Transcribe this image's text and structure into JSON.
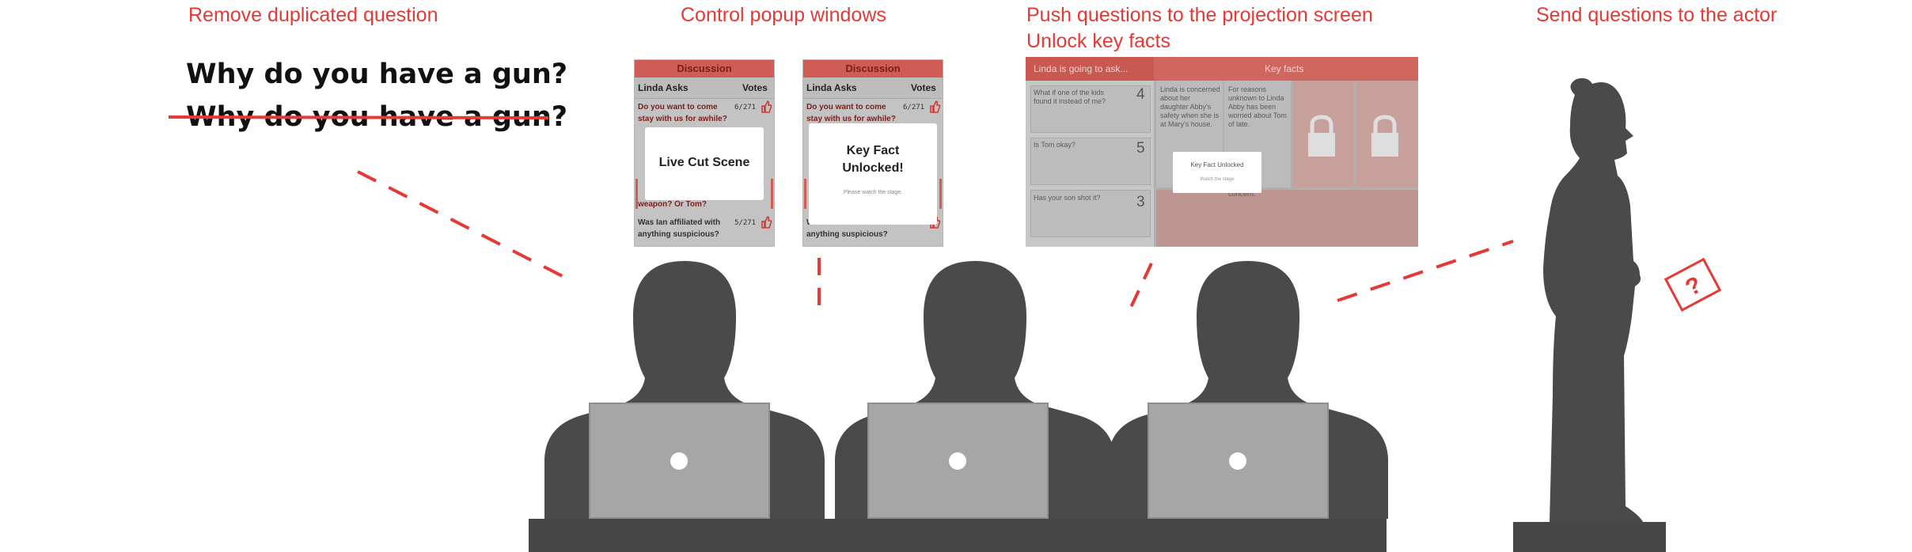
{
  "labels": {
    "remove": "Remove duplicated question",
    "control": "Control popup windows",
    "push": "Push questions to the projection screen",
    "unlock": "Unlock key facts",
    "send": "Send questions to the actor"
  },
  "duplicate_question": "Why do you have a gun?",
  "phone_left": {
    "title": "Discussion",
    "col_asks": "Linda Asks",
    "col_votes": "Votes",
    "q1_line1": "Do you want to come",
    "q1_line2": "stay with us for awhile?",
    "q1_votes": "6/271",
    "q2_partial": "weapon? Or Tom?",
    "q3_line1": "Was Ian affiliated with",
    "q3_line2": "anything suspicious?",
    "q3_votes": "5/271",
    "popup_text": "Live Cut Scene"
  },
  "phone_right": {
    "title": "Discussion",
    "col_asks": "Linda Asks",
    "col_votes": "Votes",
    "q1_line1": "Do you want to come",
    "q1_line2": "stay with us for awhile?",
    "q1_votes": "6/271",
    "q3_line1": "Was Ian affiliated with",
    "q3_line2": "anything suspicious?",
    "popup_line1": "Key Fact",
    "popup_line2": "Unlocked!",
    "popup_sub": "Please watch the stage."
  },
  "projection": {
    "left_header": "Linda is going to ask...",
    "right_header": "Key facts",
    "q1": "What if one of the kids found it instead of me?",
    "q1_votes": "4",
    "q2": "Is Tom okay?",
    "q2_votes": "5",
    "q3": "Has your son shot it?",
    "q3_votes": "3",
    "fact1": "Linda is concerned about her daughter Abby's safety when she is at Mary's house.",
    "fact2": "For reasons unknown to Linda Abby has been worried about Tom of late.",
    "fact_partial": "concern.",
    "popup_title": "Key Fact Unlocked",
    "popup_sub": "Watch the stage"
  },
  "colors": {
    "accent": "#e53935",
    "silhouette": "#4a4a4a",
    "laptop": "#a6a6a6",
    "desk": "#474747"
  },
  "icons": {
    "vote": "thumb-up-icon",
    "lock": "padlock-icon",
    "card": "question-card-icon"
  }
}
